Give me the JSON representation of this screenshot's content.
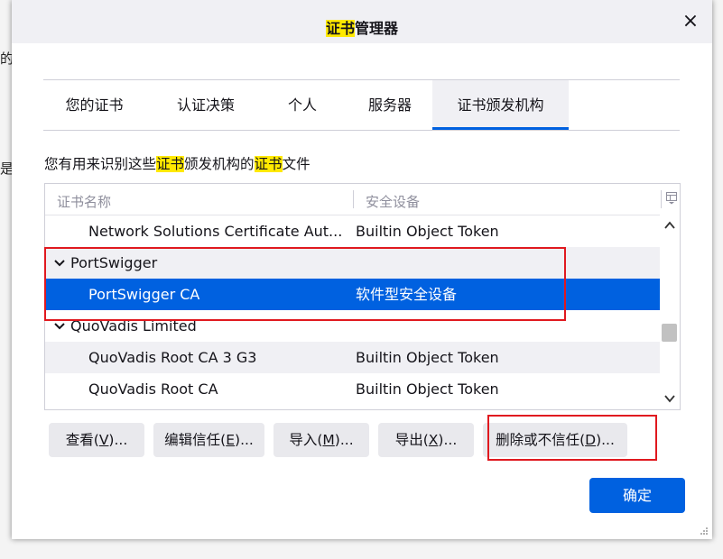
{
  "background": {
    "fragments": [
      "的",
      "是,"
    ]
  },
  "dialog": {
    "title_highlight": "证书",
    "title_rest": "管理器",
    "close_symbol": "×"
  },
  "tabs": [
    {
      "label": "您的证书",
      "active": false
    },
    {
      "label": "认证决策",
      "active": false
    },
    {
      "label": "个人",
      "active": false
    },
    {
      "label": "服务器",
      "active": false
    },
    {
      "label": "证书颁发机构",
      "active": true
    }
  ],
  "description": {
    "part1": "您有用来识别这些",
    "highlight1": "证书",
    "part2": "颁发机构的",
    "highlight2": "证书",
    "part3": "文件"
  },
  "tree": {
    "columns": {
      "name": "证书名称",
      "device": "安全设备"
    },
    "rows": [
      {
        "type": "cert",
        "name": "Network Solutions Certificate Aut...",
        "device": "Builtin Object Token",
        "shaded": false,
        "selected": false
      },
      {
        "type": "group",
        "name": "PortSwigger",
        "device": "",
        "shaded": true,
        "selected": false
      },
      {
        "type": "cert",
        "name": "PortSwigger CA",
        "device": "软件型安全设备",
        "shaded": false,
        "selected": true
      },
      {
        "type": "group",
        "name": "QuoVadis Limited",
        "device": "",
        "shaded": false,
        "selected": false
      },
      {
        "type": "cert",
        "name": "QuoVadis Root CA 3 G3",
        "device": "Builtin Object Token",
        "shaded": true,
        "selected": false
      },
      {
        "type": "cert",
        "name": "QuoVadis Root CA",
        "device": "Builtin Object Token",
        "shaded": false,
        "selected": false
      }
    ]
  },
  "buttons": {
    "view": {
      "pre": "查看(",
      "key": "V",
      "post": ")..."
    },
    "edit_trust": {
      "pre": "编辑信任(",
      "key": "E",
      "post": ")..."
    },
    "import": {
      "pre": "导入(",
      "key": "M",
      "post": ")..."
    },
    "export": {
      "pre": "导出(",
      "key": "X",
      "post": ")..."
    },
    "delete": {
      "pre": "删除或不信任(",
      "key": "D",
      "post": ")..."
    },
    "ok": "确定"
  },
  "colors": {
    "accent": "#0061e0",
    "highlight": "#ffe900",
    "annotation_red": "#e0191f"
  }
}
